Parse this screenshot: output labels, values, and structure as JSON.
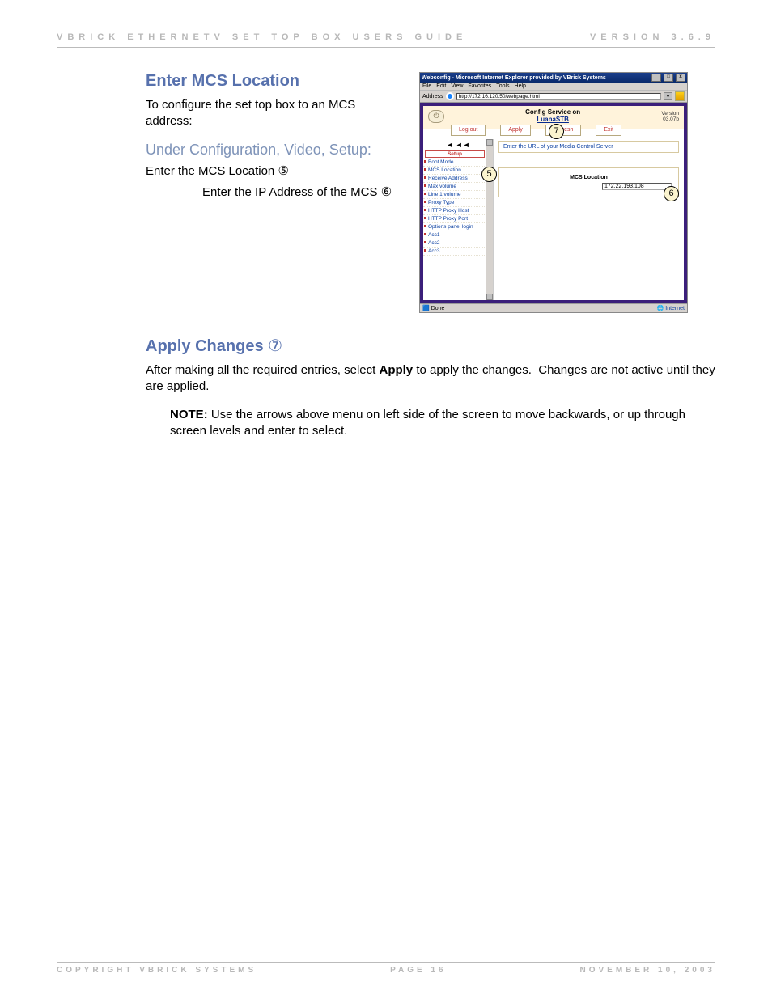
{
  "header": {
    "left": "VBRICK ETHERNETV SET TOP BOX USERS GUIDE",
    "right": "VERSION 3.6.9"
  },
  "section1": {
    "title": "Enter MCS Location",
    "intro": "To configure the set top box to an MCS address:",
    "subhead": "Under Configuration, Video, Setup:",
    "step1": "Enter the MCS Location",
    "step1_marker": "⑤",
    "step2": "Enter the IP Address of the MCS",
    "step2_marker": "⑥"
  },
  "screenshot": {
    "window_title": "Webconfig - Microsoft Internet Explorer provided by VBrick Systems",
    "menu": [
      "File",
      "Edit",
      "View",
      "Favorites",
      "Tools",
      "Help"
    ],
    "address_label": "Address",
    "address_value": "http://172.16.120.50/webpage.html",
    "config_title_line1": "Config Service on",
    "config_title_line2": "LuanaSTB",
    "version_label": "Version",
    "version_value": "03.07b",
    "tabs": {
      "logout": "Log out",
      "apply": "Apply",
      "refresh": "Refresh",
      "exit": "Exit"
    },
    "nav_arrows": "◄ ◄◄",
    "sidebar_heading": "Setup",
    "sidebar_items": [
      "Boot Mode",
      "MCS Location",
      "Receive Address",
      "Max volume",
      "Line 1 volume",
      "Proxy Type",
      "HTTP Proxy Host",
      "HTTP Proxy Port",
      "Options panel login",
      "Acc1",
      "Acc2",
      "Acc3"
    ],
    "prompt": "Enter the URL of your Media Control Server",
    "field_label": "MCS Location",
    "field_value": "172.22.193.108",
    "callouts": {
      "five": "5",
      "six": "6",
      "seven": "7"
    },
    "status_done": "Done",
    "status_zone": "Internet"
  },
  "section2": {
    "title_text": "Apply Changes",
    "title_marker": "⑦",
    "para_before_bold": "After making all the required entries, select ",
    "para_bold": "Apply",
    "para_after_bold": " to apply the changes.  Changes are not active until they are applied.",
    "note_label": "NOTE:",
    "note_body": "  Use the arrows above menu on left side of the screen to move backwards, or up through screen levels and enter to select."
  },
  "footer": {
    "left": "COPYRIGHT VBRICK SYSTEMS",
    "center": "PAGE 16",
    "right": "NOVEMBER 10, 2003"
  }
}
